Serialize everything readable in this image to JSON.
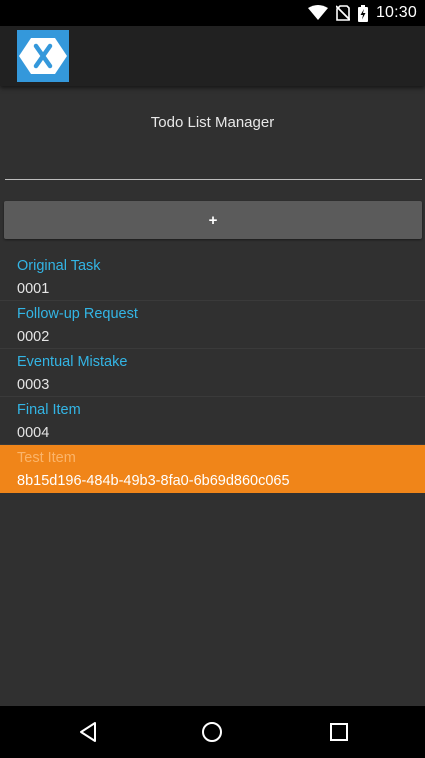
{
  "status_bar": {
    "time": "10:30",
    "icons": [
      "wifi-icon",
      "no-sim-icon",
      "battery-icon"
    ]
  },
  "app_bar": {
    "logo_icon": "xamarin-logo-icon"
  },
  "main": {
    "title": "Todo List Manager",
    "input": {
      "value": "",
      "placeholder": ""
    },
    "add_button_label": "+"
  },
  "todo_items": [
    {
      "name": "Original Task",
      "id": "0001",
      "selected": false
    },
    {
      "name": "Follow-up Request",
      "id": "0002",
      "selected": false
    },
    {
      "name": "Eventual Mistake",
      "id": "0003",
      "selected": false
    },
    {
      "name": "Final Item",
      "id": "0004",
      "selected": false
    },
    {
      "name": "Test Item",
      "id": "8b15d196-484b-49b3-8fa0-6b69d860c065",
      "selected": true
    }
  ],
  "nav_bar": {
    "buttons": [
      "back-icon",
      "home-icon",
      "recents-icon"
    ]
  },
  "colors": {
    "accent": "#33b5e5",
    "selected_bg": "#f08519",
    "background": "#303030",
    "app_bar": "#212121",
    "logo": "#3498db"
  }
}
